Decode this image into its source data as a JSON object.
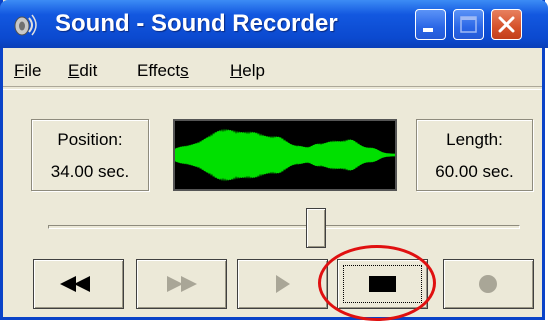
{
  "window": {
    "title": "Sound - Sound Recorder",
    "controls": {
      "minimize": "minimize",
      "maximize": "maximize",
      "close": "close"
    }
  },
  "menu": {
    "items": [
      {
        "pre": "",
        "key": "F",
        "post": "ile"
      },
      {
        "pre": "",
        "key": "E",
        "post": "dit"
      },
      {
        "pre": "Effect",
        "key": "s",
        "post": ""
      },
      {
        "pre": "",
        "key": "H",
        "post": "elp"
      }
    ]
  },
  "position": {
    "label": "Position:",
    "value": "34.00 sec."
  },
  "length": {
    "label": "Length:",
    "value": "60.00 sec."
  },
  "waveform": {
    "color": "#00e000",
    "background": "#000000"
  },
  "seek": {
    "fraction": 0.567
  },
  "transport": {
    "buttons": [
      {
        "name": "seek-to-start",
        "icon": "rewind-icon",
        "enabled": true
      },
      {
        "name": "seek-to-end",
        "icon": "fast-forward-icon",
        "enabled": false
      },
      {
        "name": "play",
        "icon": "play-icon",
        "enabled": false
      },
      {
        "name": "stop",
        "icon": "stop-icon",
        "enabled": true,
        "focused": true
      },
      {
        "name": "record",
        "icon": "record-icon",
        "enabled": false
      }
    ]
  },
  "annotation": {
    "color": "#e01010",
    "target": "stop"
  }
}
